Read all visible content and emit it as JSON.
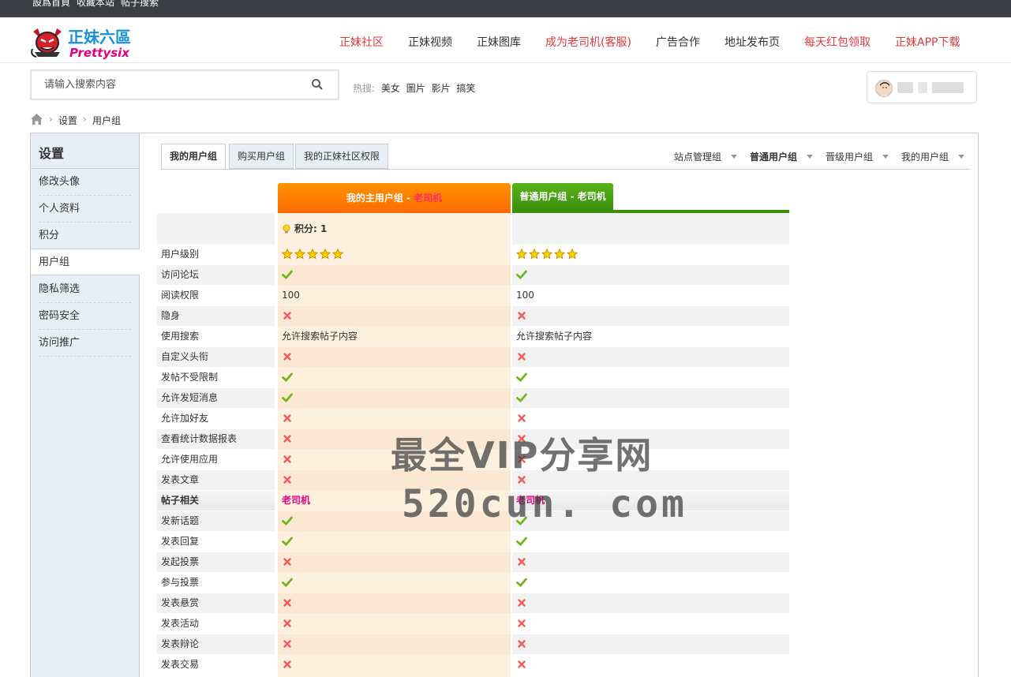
{
  "topbar": {
    "links": [
      "設爲首頁",
      "收藏本站",
      "帖子搜索"
    ]
  },
  "header": {
    "logo_text": "正妹六區",
    "logo_sub": "Prettysix",
    "nav": [
      {
        "label": "正妹社区",
        "color": "#e4393c"
      },
      {
        "label": "正妹视频",
        "color": "#333333"
      },
      {
        "label": "正妹图库",
        "color": "#333333"
      },
      {
        "label": "成为老司机(客服)",
        "color": "#e4393c"
      },
      {
        "label": "广告合作",
        "color": "#333333"
      },
      {
        "label": "地址发布页",
        "color": "#333333"
      },
      {
        "label": "每天红包领取",
        "color": "#e4393c"
      },
      {
        "label": "正妹APP下载",
        "color": "#e4393c"
      }
    ]
  },
  "search": {
    "placeholder": "请输入搜索内容",
    "hot_label": "热搜:",
    "hot_words": [
      "美女",
      "圖片",
      "影片",
      "搞笑"
    ]
  },
  "breadcrumb": {
    "items": [
      "设置",
      "用户组"
    ]
  },
  "sidebar": {
    "title": "设置",
    "items": [
      {
        "label": "修改头像",
        "active": false
      },
      {
        "label": "个人资料",
        "active": false
      },
      {
        "label": "积分",
        "active": false
      },
      {
        "label": "用户组",
        "active": true
      },
      {
        "label": "隐私筛选",
        "active": false
      },
      {
        "label": "密码安全",
        "active": false
      },
      {
        "label": "访问推广",
        "active": false
      }
    ]
  },
  "tabs": [
    {
      "label": "我的用户组",
      "active": true
    },
    {
      "label": "购买用户组",
      "active": false
    },
    {
      "label": "我的正妹社区权限",
      "active": false
    }
  ],
  "group_selectors": [
    {
      "label": "站点管理组",
      "bold": false
    },
    {
      "label": "普通用户组",
      "bold": true
    },
    {
      "label": "晋级用户组",
      "bold": false
    },
    {
      "label": "我的用户组",
      "bold": false
    }
  ],
  "table": {
    "col1_header": "我的主用户组 - ",
    "col1_rank": "老司机",
    "col2_header": "普通用户组 - 老司机",
    "points_label": "积分: 1",
    "colors": {
      "accent_orange": "#ff7a00",
      "accent_green": "#3c8f0a",
      "section_pink": "#e4007f"
    },
    "rows": [
      {
        "label": "用户级别",
        "c1": "stars",
        "c2": "stars",
        "stars": 5
      },
      {
        "label": "访问论坛",
        "c1": "yes",
        "c2": "yes"
      },
      {
        "label": "阅读权限",
        "c1": "100",
        "c2": "100"
      },
      {
        "label": "隐身",
        "c1": "no",
        "c2": "no"
      },
      {
        "label": "使用搜索",
        "c1": "允许搜索帖子内容",
        "c2": "允许搜索帖子内容"
      },
      {
        "label": "自定义头衔",
        "c1": "no",
        "c2": "no"
      },
      {
        "label": "发帖不受限制",
        "c1": "yes",
        "c2": "yes"
      },
      {
        "label": "允许发短消息",
        "c1": "yes",
        "c2": "yes"
      },
      {
        "label": "允许加好友",
        "c1": "no",
        "c2": "no"
      },
      {
        "label": "查看统计数据报表",
        "c1": "no",
        "c2": "no"
      },
      {
        "label": "允许使用应用",
        "c1": "no",
        "c2": "no"
      },
      {
        "label": "发表文章",
        "c1": "no",
        "c2": "no"
      },
      {
        "label": "帖子相关",
        "c1": "老司机",
        "c2": "老司机",
        "section": true
      },
      {
        "label": "发新话题",
        "c1": "yes",
        "c2": "yes"
      },
      {
        "label": "发表回复",
        "c1": "yes",
        "c2": "yes"
      },
      {
        "label": "发起投票",
        "c1": "no",
        "c2": "no"
      },
      {
        "label": "参与投票",
        "c1": "yes",
        "c2": "yes"
      },
      {
        "label": "发表悬赏",
        "c1": "no",
        "c2": "no"
      },
      {
        "label": "发表活动",
        "c1": "no",
        "c2": "no"
      },
      {
        "label": "发表辩论",
        "c1": "no",
        "c2": "no"
      },
      {
        "label": "发表交易",
        "c1": "no",
        "c2": "no"
      }
    ]
  },
  "watermark": {
    "line1": "最全VIP分享网",
    "line2": "520cun. com"
  }
}
